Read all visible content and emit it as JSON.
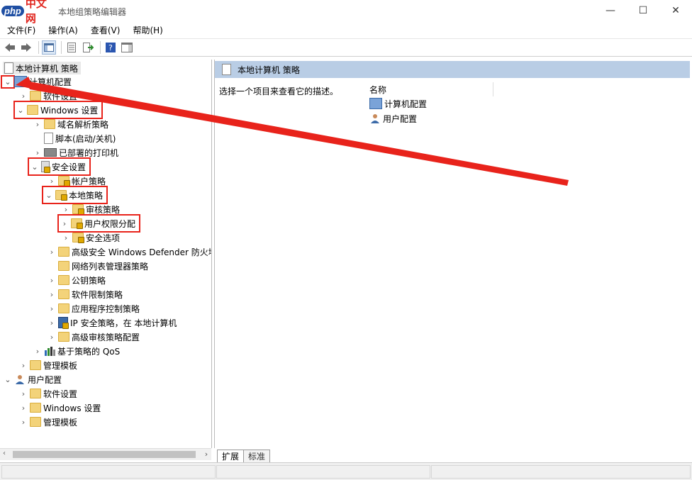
{
  "window": {
    "title": "本地组策略编辑器",
    "logo_text": "php",
    "logo_cn": "中文网"
  },
  "window_controls": {
    "minimize": "—",
    "maximize": "☐",
    "close": "✕"
  },
  "menu": [
    "文件(F)",
    "操作(A)",
    "查看(V)",
    "帮助(H)"
  ],
  "tree": {
    "root": "本地计算机 策略",
    "computer_config": "计算机配置",
    "software_settings": "软件设置",
    "windows_settings": "Windows 设置",
    "name_resolution": "域名解析策略",
    "scripts": "脚本(启动/关机)",
    "printers": "已部署的打印机",
    "security_settings": "安全设置",
    "account_policies": "帐户策略",
    "local_policies": "本地策略",
    "audit_policy": "审核策略",
    "user_rights": "用户权限分配",
    "security_options": "安全选项",
    "defender_firewall": "高级安全 Windows Defender 防火墙",
    "network_list": "网络列表管理器策略",
    "public_key": "公钥策略",
    "software_restriction": "软件限制策略",
    "app_control": "应用程序控制策略",
    "ip_security": "IP 安全策略，在 本地计算机",
    "advanced_audit": "高级审核策略配置",
    "qos": "基于策略的 QoS",
    "admin_templates": "管理模板",
    "user_config": "用户配置",
    "user_software": "软件设置",
    "user_windows": "Windows 设置",
    "user_admin_templates": "管理模板"
  },
  "right": {
    "header": "本地计算机 策略",
    "description": "选择一个项目来查看它的描述。",
    "column_name": "名称",
    "items": [
      "计算机配置",
      "用户配置"
    ]
  },
  "tabs": [
    "扩展",
    "标准"
  ],
  "colors": {
    "annotation": "#e8231b",
    "header_bg": "#b9cde5"
  }
}
